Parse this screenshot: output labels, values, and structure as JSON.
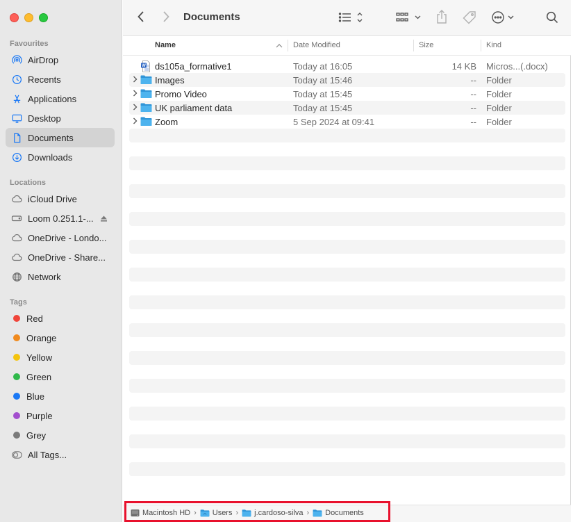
{
  "window": {
    "title": "Documents"
  },
  "sidebar": {
    "sections": {
      "favourites": "Favourites",
      "locations": "Locations",
      "tags": "Tags"
    },
    "favourites": [
      {
        "label": "AirDrop",
        "icon": "airdrop-icon"
      },
      {
        "label": "Recents",
        "icon": "clock-icon"
      },
      {
        "label": "Applications",
        "icon": "applications-icon"
      },
      {
        "label": "Desktop",
        "icon": "desktop-icon"
      },
      {
        "label": "Documents",
        "icon": "document-icon",
        "active": true
      },
      {
        "label": "Downloads",
        "icon": "download-icon"
      }
    ],
    "locations": [
      {
        "label": "iCloud Drive",
        "icon": "cloud-icon"
      },
      {
        "label": "Loom 0.251.1-...",
        "icon": "drive-icon"
      },
      {
        "label": "OneDrive - Londo...",
        "icon": "cloud-icon"
      },
      {
        "label": "OneDrive - Share...",
        "icon": "cloud-icon"
      },
      {
        "label": "Network",
        "icon": "globe-icon"
      }
    ],
    "tags": [
      {
        "label": "Red",
        "color": "#f0453a"
      },
      {
        "label": "Orange",
        "color": "#f08a1e"
      },
      {
        "label": "Yellow",
        "color": "#f4c40f"
      },
      {
        "label": "Green",
        "color": "#30b94b"
      },
      {
        "label": "Blue",
        "color": "#1a78f5"
      },
      {
        "label": "Purple",
        "color": "#a34fce"
      },
      {
        "label": "Grey",
        "color": "#7a7a7a"
      },
      {
        "label": "All Tags...",
        "color": ""
      }
    ]
  },
  "columns": {
    "name": "Name",
    "date": "Date Modified",
    "size": "Size",
    "kind": "Kind"
  },
  "files": [
    {
      "name": "ds105a_formative1",
      "date": "Today at 16:05",
      "size": "14 KB",
      "kind": "Micros...(.docx)",
      "type": "docx"
    },
    {
      "name": "Images",
      "date": "Today at 15:46",
      "size": "--",
      "kind": "Folder",
      "type": "folder"
    },
    {
      "name": "Promo Video",
      "date": "Today at 15:45",
      "size": "--",
      "kind": "Folder",
      "type": "folder"
    },
    {
      "name": "UK parliament data",
      "date": "Today at 15:45",
      "size": "--",
      "kind": "Folder",
      "type": "folder"
    },
    {
      "name": "Zoom",
      "date": "5 Sep 2024 at 09:41",
      "size": "--",
      "kind": "Folder",
      "type": "folder"
    }
  ],
  "pathbar": [
    "Macintosh HD",
    "Users",
    "j.cardoso-silva",
    "Documents"
  ],
  "colors": {
    "accent": "#1a78f5",
    "folder": "#3aa8e8",
    "highlight": "#e8112d"
  }
}
